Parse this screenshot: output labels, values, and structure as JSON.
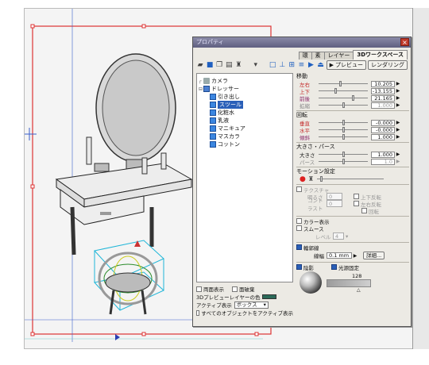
{
  "panel": {
    "title": "プロパティ",
    "tabs": [
      {
        "label": "環"
      },
      {
        "label": "素"
      },
      {
        "label": "レイヤー"
      },
      {
        "label": "3Dワークスペース"
      }
    ],
    "preview_label": "プレビュー",
    "render_label": "レンダリング"
  },
  "tree": [
    {
      "label": "カメラ",
      "icon": "camera-icon",
      "level": 0
    },
    {
      "label": "ドレッサー",
      "icon": "group-icon",
      "level": 0
    },
    {
      "label": "引き出し",
      "icon": "object-icon",
      "level": 1
    },
    {
      "label": "スツール",
      "icon": "object-icon",
      "level": 1,
      "selected": true
    },
    {
      "label": "化粧水",
      "icon": "object-icon",
      "level": 1
    },
    {
      "label": "乳液",
      "icon": "object-icon",
      "level": 1
    },
    {
      "label": "マニキュア",
      "icon": "object-icon",
      "level": 1
    },
    {
      "label": "マスカラ",
      "icon": "object-icon",
      "level": 1
    },
    {
      "label": "コットン",
      "icon": "object-icon",
      "level": 1
    }
  ],
  "move": {
    "label": "移動",
    "rows": [
      {
        "name": "左右",
        "value": "10.205"
      },
      {
        "name": "上下",
        "value": "-13.155"
      },
      {
        "name": "前後",
        "value": "21.165"
      },
      {
        "name": "拡縮",
        "value": "1.000"
      }
    ]
  },
  "rotate": {
    "label": "回転",
    "rows": [
      {
        "name": "垂直",
        "value": "-0.000"
      },
      {
        "name": "水平",
        "value": "-0.000"
      },
      {
        "name": "傾斜",
        "value": "1.000"
      }
    ]
  },
  "size_perspective": {
    "label": "大きさ・パース",
    "rows": [
      {
        "name": "大きさ",
        "value": "1.000"
      },
      {
        "name": "パース",
        "value": "1.0"
      }
    ]
  },
  "motion": {
    "label": "モーション設定"
  },
  "texture": {
    "label": "テクスチャ",
    "brightness_label": "明るさ",
    "brightness_value": "0",
    "contrast_label": "コントラスト",
    "contrast_value": "0",
    "flip_v": "上下反転",
    "flip_h": "左右反転",
    "rotate": "回転"
  },
  "color_display": "カラー表示",
  "smooth": {
    "label": "スムース",
    "level_label": "レベル",
    "level_value": "4"
  },
  "lines": {
    "label": "輪郭線",
    "width_label": "線幅",
    "width_value": "0.1 mm",
    "detail_label": "詳細..."
  },
  "shadow": {
    "label": "陰影",
    "light_label": "光源固定",
    "value": "128"
  },
  "bottom": {
    "two_sided": "両面表示",
    "hide_back": "面破棄",
    "preview_color_label": "3Dプレビューレイヤーの色",
    "active_display_label": "アクティブ表示",
    "active_display_value": "ボックス",
    "all_objects": "すべてのオブジェクトをアクティブ表示"
  },
  "colors": {
    "preview_layer": "#2a6a58",
    "accent": "#2a5fb8",
    "title": "#5f5f80"
  }
}
